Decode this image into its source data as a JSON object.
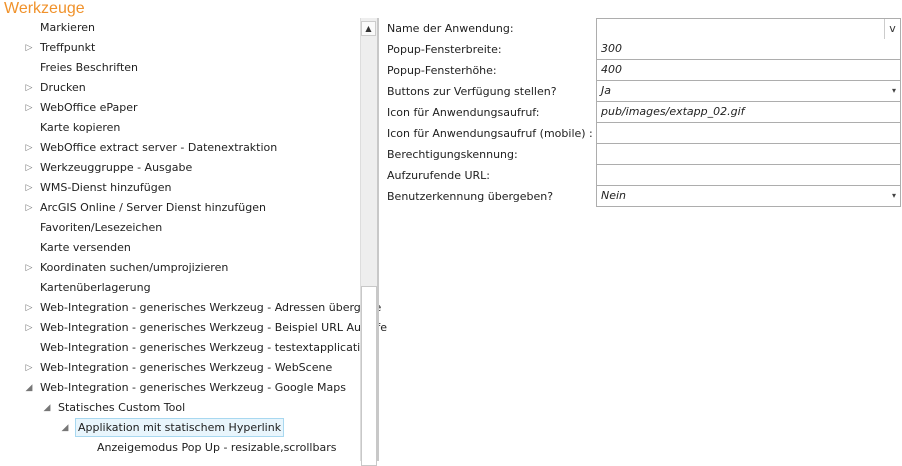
{
  "title": "Werkzeuge",
  "tree": [
    {
      "label": "Markieren",
      "level": 0,
      "arrow": ""
    },
    {
      "label": "Treffpunkt",
      "level": 0,
      "arrow": "▷"
    },
    {
      "label": "Freies Beschriften",
      "level": 0,
      "arrow": ""
    },
    {
      "label": "Drucken",
      "level": 0,
      "arrow": "▷"
    },
    {
      "label": "WebOffice ePaper",
      "level": 0,
      "arrow": "▷"
    },
    {
      "label": "Karte kopieren",
      "level": 0,
      "arrow": ""
    },
    {
      "label": "WebOffice extract server - Datenextraktion",
      "level": 0,
      "arrow": "▷"
    },
    {
      "label": "Werkzeuggruppe - Ausgabe",
      "level": 0,
      "arrow": "▷"
    },
    {
      "label": "WMS-Dienst hinzufügen",
      "level": 0,
      "arrow": "▷"
    },
    {
      "label": "ArcGIS Online / Server Dienst hinzufügen",
      "level": 0,
      "arrow": "▷"
    },
    {
      "label": "Favoriten/Lesezeichen",
      "level": 0,
      "arrow": ""
    },
    {
      "label": "Karte versenden",
      "level": 0,
      "arrow": ""
    },
    {
      "label": "Koordinaten suchen/umprojizieren",
      "level": 0,
      "arrow": "▷"
    },
    {
      "label": "Kartenüberlagerung",
      "level": 0,
      "arrow": ""
    },
    {
      "label": "Web-Integration - generisches Werkzeug - Adressen übergebe",
      "level": 0,
      "arrow": "▷"
    },
    {
      "label": "Web-Integration - generisches Werkzeug - Beispiel URL Aufrufe",
      "level": 0,
      "arrow": "▷"
    },
    {
      "label": "Web-Integration - generisches Werkzeug - testextapplication",
      "level": 0,
      "arrow": ""
    },
    {
      "label": "Web-Integration - generisches Werkzeug - WebScene",
      "level": 0,
      "arrow": "▷"
    },
    {
      "label": "Web-Integration - generisches Werkzeug - Google Maps",
      "level": 0,
      "arrow": "◢"
    },
    {
      "label": "Statisches Custom Tool",
      "level": 1,
      "arrow": "◢"
    },
    {
      "label": "Applikation mit statischem Hyperlink",
      "level": 2,
      "arrow": "◢",
      "selected": true
    },
    {
      "label": "Anzeigemodus Pop Up - resizable,scrollbars",
      "level": 3,
      "arrow": ""
    }
  ],
  "scroll_up": "▲",
  "form": [
    {
      "label": "Name der Anwendung:",
      "value": "",
      "button": "v"
    },
    {
      "label": "Popup-Fensterbreite:",
      "value": "300"
    },
    {
      "label": "Popup-Fensterhöhe:",
      "value": "400"
    },
    {
      "label": "Buttons zur Verfügung stellen?",
      "value": "Ja",
      "dropdown": "▾"
    },
    {
      "label": "Icon für Anwendungsaufruf:",
      "value": "pub/images/extapp_02.gif"
    },
    {
      "label": "Icon für Anwendungsaufruf (mobile) :",
      "value": ""
    },
    {
      "label": "Berechtigungskennung:",
      "value": ""
    },
    {
      "label": "Aufzurufende URL:",
      "value": ""
    },
    {
      "label": "Benutzerkennung übergeben?",
      "value": "Nein",
      "dropdown": "▾"
    }
  ]
}
